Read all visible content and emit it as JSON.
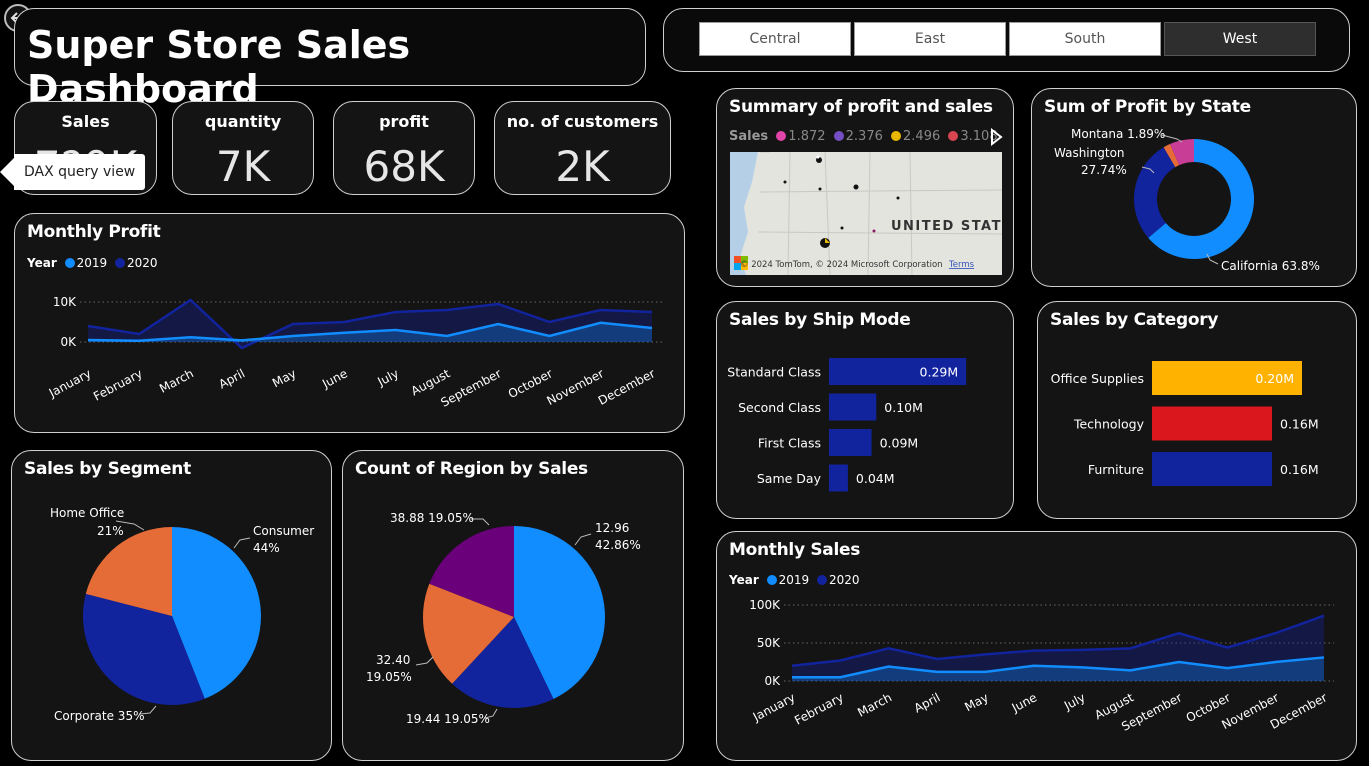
{
  "title": "Super Store Sales Dashboard",
  "back_icon": "back-arrow-icon",
  "slicer": {
    "items": [
      "Central",
      "East",
      "South",
      "West"
    ],
    "selected": "West"
  },
  "kpis": [
    {
      "label": "Sales",
      "value": "7?0K"
    },
    {
      "label": "quantity",
      "value": "7K"
    },
    {
      "label": "profit",
      "value": "68K"
    },
    {
      "label": "no. of customers",
      "value": "2K"
    }
  ],
  "tooltip": "DAX query view",
  "colors": {
    "y2019": "#118dff",
    "y2020": "#12239e",
    "orange": "#e66c37",
    "purple": "#6b007b",
    "yellow": "#ffb300",
    "red": "#d9171c"
  },
  "monthly_profit": {
    "title": "Monthly Profit",
    "legend_label": "Year",
    "series_names": [
      "2019",
      "2020"
    ],
    "y_ticks": [
      "10K",
      "0K"
    ]
  },
  "monthly_sales": {
    "title": "Monthly Sales",
    "legend_label": "Year",
    "series_names": [
      "2019",
      "2020"
    ],
    "y_ticks": [
      "100K",
      "50K",
      "0K"
    ]
  },
  "summary_map": {
    "title": "Summary of profit and sales",
    "legend_label": "Sales",
    "legend_items": [
      "1.872",
      "2.376",
      "2.496",
      "3.108"
    ],
    "map_label": "UNITED STATE",
    "attribution": "© 2024 TomTom, © 2024 Microsoft Corporation",
    "terms": "Terms"
  },
  "profit_by_state": {
    "title": "Sum of Profit by State",
    "labels": {
      "montana": "Montana 1.89%",
      "washington_name": "Washington",
      "washington_pct": "27.74%",
      "california": "California 63.8%"
    }
  },
  "ship_mode": {
    "title": "Sales by Ship Mode"
  },
  "category": {
    "title": "Sales by Category"
  },
  "segment": {
    "title": "Sales by Segment",
    "labels": {
      "home_office_name": "Home Office",
      "home_office_pct": "21%",
      "consumer_name": "Consumer",
      "consumer_pct": "44%",
      "corporate": "Corporate 35%"
    }
  },
  "region": {
    "title": "Count of Region by Sales",
    "labels": {
      "a1": "38.88 19.05%",
      "b1": "12.96",
      "b2": "42.86%",
      "c1": "32.40",
      "c2": "19.05%",
      "d1": "19.44 19.05%"
    }
  },
  "chart_data": [
    {
      "type": "area",
      "title": "Monthly Profit",
      "categories": [
        "January",
        "February",
        "March",
        "April",
        "May",
        "June",
        "July",
        "August",
        "September",
        "October",
        "November",
        "December"
      ],
      "series": [
        {
          "name": "2019",
          "values": [
            0.5,
            0.3,
            1.2,
            0.4,
            1.5,
            2.3,
            3.0,
            1.5,
            4.5,
            1.5,
            4.8,
            3.5
          ]
        },
        {
          "name": "2020",
          "values": [
            4.0,
            2.0,
            10.5,
            -1.5,
            4.5,
            5.0,
            7.5,
            8.0,
            9.5,
            5.0,
            8.0,
            7.5
          ]
        }
      ],
      "ylim": [
        -2,
        12
      ],
      "y_ticks": [
        0,
        10
      ]
    },
    {
      "type": "area",
      "title": "Monthly Sales",
      "categories": [
        "January",
        "February",
        "March",
        "April",
        "May",
        "June",
        "July",
        "August",
        "September",
        "October",
        "November",
        "December"
      ],
      "series": [
        {
          "name": "2019",
          "values": [
            5,
            5,
            19,
            12,
            12,
            20,
            18,
            14,
            25,
            17,
            25,
            31
          ]
        },
        {
          "name": "2020",
          "values": [
            20,
            27,
            43,
            29,
            35,
            40,
            41,
            43,
            63,
            44,
            63,
            86
          ]
        }
      ],
      "ylim": [
        0,
        100
      ],
      "y_ticks": [
        0,
        50,
        100
      ]
    },
    {
      "type": "bar",
      "title": "Sales by Ship Mode",
      "categories": [
        "Standard Class",
        "Second Class",
        "First Class",
        "Same Day"
      ],
      "values": [
        0.29,
        0.1,
        0.09,
        0.04
      ],
      "value_labels": [
        "0.29M",
        "0.10M",
        "0.09M",
        "0.04M"
      ],
      "orientation": "horizontal"
    },
    {
      "type": "bar",
      "title": "Sales by Category",
      "categories": [
        "Office Supplies",
        "Technology",
        "Furniture"
      ],
      "values": [
        0.2,
        0.16,
        0.16
      ],
      "value_labels": [
        "0.20M",
        "0.16M",
        "0.16M"
      ],
      "colors": [
        "#ffb300",
        "#d9171c",
        "#12239e"
      ],
      "orientation": "horizontal"
    },
    {
      "type": "pie",
      "title": "Sales by Segment",
      "categories": [
        "Consumer",
        "Corporate",
        "Home Office"
      ],
      "values": [
        44,
        35,
        21
      ],
      "colors": [
        "#118dff",
        "#12239e",
        "#e66c37"
      ]
    },
    {
      "type": "pie",
      "title": "Count of Region by Sales",
      "categories": [
        "12.96",
        "19.44",
        "32.40",
        "38.88"
      ],
      "values": [
        42.86,
        19.05,
        19.05,
        19.05
      ],
      "colors": [
        "#118dff",
        "#12239e",
        "#e66c37",
        "#6b007b"
      ]
    },
    {
      "type": "pie",
      "title": "Sum of Profit by State",
      "categories": [
        "California",
        "Washington",
        "Montana",
        "Other"
      ],
      "values": [
        63.8,
        27.74,
        1.89,
        6.57
      ],
      "colors": [
        "#118dff",
        "#12239e",
        "#e66c37",
        "#c83d95"
      ],
      "donut": true
    }
  ]
}
